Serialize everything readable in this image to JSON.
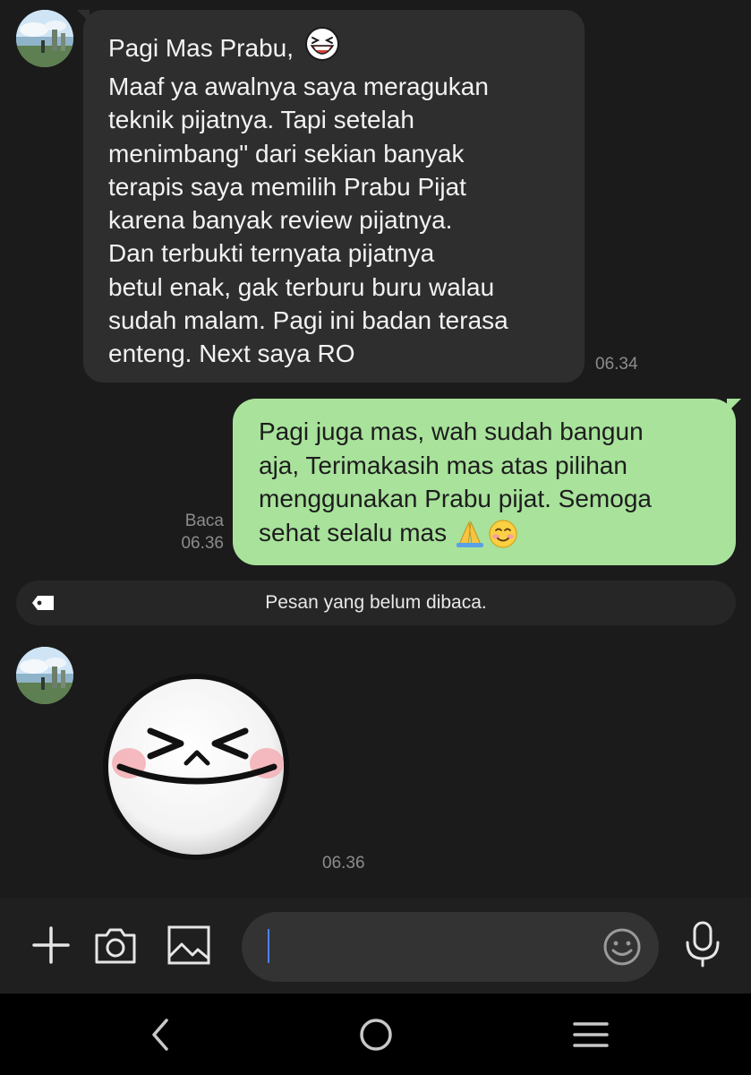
{
  "conversation": {
    "incoming_message": {
      "greeting": "Pagi Mas Prabu,",
      "greeting_emoji": "laughing-face-sticker-emoji",
      "body": "Maaf ya awalnya saya meragukan\nteknik pijatnya. Tapi setelah\nmenimbang\" dari sekian banyak\nterapis saya memilih Prabu Pijat\nkarena banyak review pijatnya.\nDan terbukti ternyata pijatnya\nbetul enak, gak terburu buru walau\nsudah malam. Pagi ini badan terasa\nenteng. Next saya RO",
      "time": "06.34"
    },
    "outgoing_message": {
      "body": "Pagi juga mas, wah sudah bangun\naja, Terimakasih mas atas pilihan\nmenggunakan Prabu pijat. Semoga\nsehat selalu mas ",
      "emojis": [
        "folded-hands-emoji",
        "smiling-face-emoji"
      ],
      "read_label": "Baca",
      "time": "06.36"
    },
    "unread_divider": {
      "label": "Pesan yang belum dibaca.",
      "icon": "tag-icon"
    },
    "sticker_message": {
      "sticker": "laughing-moon-face-sticker",
      "time": "06.36"
    }
  },
  "composer": {
    "input_value": "",
    "buttons": [
      "plus-icon",
      "camera-icon",
      "image-icon",
      "emoji-icon",
      "microphone-icon"
    ]
  },
  "navbar": {
    "buttons": [
      "back-icon",
      "home-icon",
      "recent-apps-icon"
    ]
  },
  "colors": {
    "background": "#1b1b1b",
    "incoming_bubble": "#2e2e2e",
    "outgoing_bubble": "#a8e29b",
    "caret": "#4d82ff"
  }
}
